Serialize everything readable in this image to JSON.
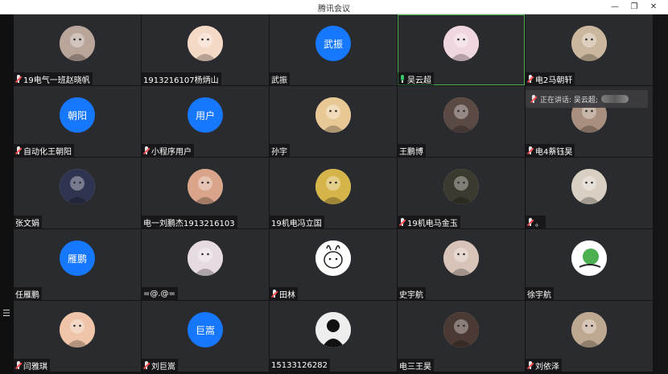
{
  "window": {
    "title": "腾讯会议"
  },
  "window_buttons": [
    {
      "name": "minimize-button",
      "glyph": "—"
    },
    {
      "name": "restore-button",
      "glyph": "❐"
    },
    {
      "name": "close-button",
      "glyph": "✕"
    }
  ],
  "speaking_indicator": {
    "text": "正在讲话: 吴云超;"
  },
  "participants": [
    {
      "name": "19电气一班赵晓帆",
      "avatar": {
        "kind": "photo",
        "icon": "cat-photo-avatar",
        "color": "#b9a59a"
      },
      "mic": "muted",
      "active": false
    },
    {
      "name": "1913216107杨炳山",
      "avatar": {
        "kind": "photo",
        "icon": "cartoon-boy-avatar",
        "color": "#f4d9c6"
      },
      "mic": "none",
      "active": false
    },
    {
      "name": "武振",
      "avatar": {
        "kind": "text",
        "text": "武振"
      },
      "mic": "none",
      "active": false
    },
    {
      "name": "吴云超",
      "avatar": {
        "kind": "photo",
        "icon": "cartoon-girl-avatar",
        "color": "#f0d6de"
      },
      "mic": "on",
      "active": true
    },
    {
      "name": "电2马朝轩",
      "avatar": {
        "kind": "photo",
        "icon": "anime-avatar",
        "color": "#cbb79d"
      },
      "mic": "muted",
      "active": false
    },
    {
      "name": "自动化王朝阳",
      "avatar": {
        "kind": "text",
        "text": "朝阳"
      },
      "mic": "muted",
      "active": false
    },
    {
      "name": "小程序用户",
      "avatar": {
        "kind": "text",
        "text": "用户"
      },
      "mic": "muted",
      "active": false
    },
    {
      "name": "孙宇",
      "avatar": {
        "kind": "photo",
        "icon": "cartoon-face-avatar",
        "color": "#e8c996"
      },
      "mic": "none",
      "active": false
    },
    {
      "name": "王鹏博",
      "avatar": {
        "kind": "photo",
        "icon": "sunglasses-avatar",
        "color": "#5b4a44"
      },
      "mic": "none",
      "active": false
    },
    {
      "name": "电4蔡钰昊",
      "avatar": {
        "kind": "photo",
        "icon": "person-photo-avatar",
        "color": "#a98f7d"
      },
      "mic": "muted",
      "active": false
    },
    {
      "name": "张文娟",
      "avatar": {
        "kind": "photo",
        "icon": "anime-girl-avatar",
        "color": "#2f3550"
      },
      "mic": "none",
      "active": false
    },
    {
      "name": "电一刘鹏杰1913216103",
      "avatar": {
        "kind": "photo",
        "icon": "girl-photo-avatar",
        "color": "#d9a48a"
      },
      "mic": "none",
      "active": false
    },
    {
      "name": "19机电冯立国",
      "avatar": {
        "kind": "photo",
        "icon": "cartoon-glasses-avatar",
        "color": "#d5b54a"
      },
      "mic": "none",
      "active": false
    },
    {
      "name": "19机电马金玉",
      "avatar": {
        "kind": "photo",
        "icon": "painting-avatar",
        "color": "#3a3a2e"
      },
      "mic": "muted",
      "active": false
    },
    {
      "name": "。",
      "avatar": {
        "kind": "photo",
        "icon": "anime-boy-avatar",
        "color": "#d9cfc3"
      },
      "mic": "muted",
      "active": false
    },
    {
      "name": "任雁鹏",
      "avatar": {
        "kind": "text",
        "text": "雁鹏"
      },
      "mic": "none",
      "active": false
    },
    {
      "name": "=@.@=",
      "avatar": {
        "kind": "photo",
        "icon": "chibi-avatar",
        "color": "#e6dbe2"
      },
      "mic": "none",
      "active": false
    },
    {
      "name": "田林",
      "avatar": {
        "kind": "photo",
        "icon": "rabbit-sketch-avatar",
        "color": "#f3f3f3"
      },
      "mic": "muted",
      "active": false
    },
    {
      "name": "史宇航",
      "avatar": {
        "kind": "photo",
        "icon": "white-cat-avatar",
        "color": "#d7c3b8"
      },
      "mic": "none",
      "active": false
    },
    {
      "name": "徐宇航",
      "avatar": {
        "kind": "photo",
        "icon": "green-ball-avatar",
        "color": "#ffffff"
      },
      "mic": "none",
      "active": false
    },
    {
      "name": "闫雅琪",
      "avatar": {
        "kind": "photo",
        "icon": "child-photo-avatar",
        "color": "#efc4a8"
      },
      "mic": "muted",
      "active": false
    },
    {
      "name": "刘巨嵩",
      "avatar": {
        "kind": "text",
        "text": "巨嵩"
      },
      "mic": "muted",
      "active": false
    },
    {
      "name": "15133126282",
      "avatar": {
        "kind": "photo",
        "icon": "silhouette-avatar",
        "color": "#111111"
      },
      "mic": "none",
      "active": false
    },
    {
      "name": "电三王昊",
      "avatar": {
        "kind": "photo",
        "icon": "man-photo-avatar",
        "color": "#4b3a33"
      },
      "mic": "none",
      "active": false
    },
    {
      "name": "刘依泽",
      "avatar": {
        "kind": "photo",
        "icon": "guy-photo-avatar",
        "color": "#bfa891"
      },
      "mic": "muted",
      "active": false
    }
  ]
}
